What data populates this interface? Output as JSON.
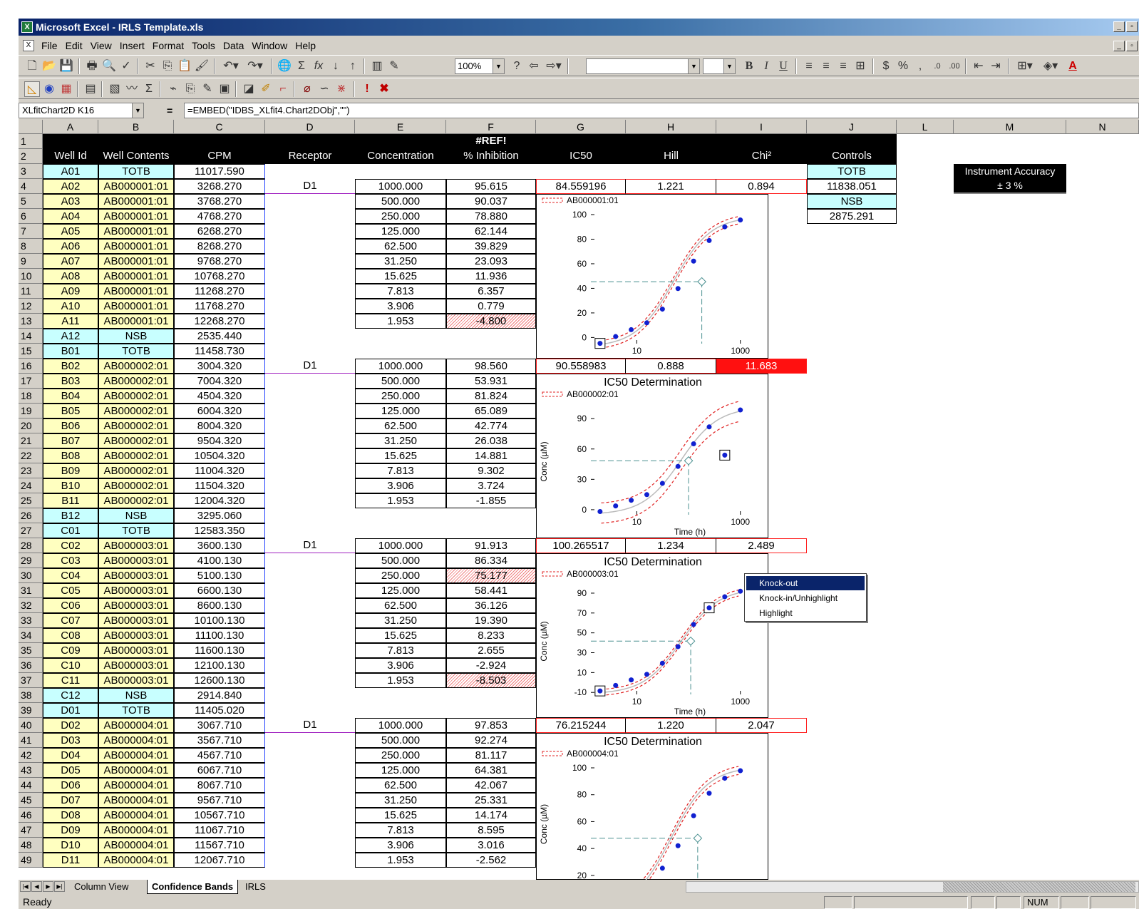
{
  "window": {
    "title": "Microsoft Excel - IRLS Template.xls"
  },
  "menu": [
    "File",
    "Edit",
    "View",
    "Insert",
    "Format",
    "Tools",
    "Data",
    "Window",
    "Help"
  ],
  "toolbar": {
    "zoom": "100%"
  },
  "formula_bar": {
    "name_box": "XLfitChart2D K16",
    "equals": "=",
    "formula": "=EMBED(\"IDBS_XLfit4.Chart2DObj\",\"\")"
  },
  "columns": [
    "A",
    "B",
    "C",
    "D",
    "E",
    "F",
    "G",
    "H",
    "I",
    "J",
    "L",
    "M",
    "N"
  ],
  "headers": {
    "ref": "#REF!",
    "well_id": "Well Id",
    "well_contents": "Well Contents",
    "cpm": "CPM",
    "receptor": "Receptor",
    "concentration": "Concentration",
    "inhibition": "% Inhibition",
    "ic50": "IC50",
    "hill": "Hill",
    "chi": "Chi²",
    "controls": "Controls"
  },
  "controls": {
    "totb_label": "TOTB",
    "totb_value": "11838.051",
    "nsb_label": "NSB",
    "nsb_value": "2875.291"
  },
  "accuracy": {
    "line1": "Instrument Accuracy",
    "line2": "± 3 %"
  },
  "rows": [
    {
      "r": "1"
    },
    {
      "r": "2"
    },
    {
      "r": "3",
      "a": "A01",
      "b": "TOTB",
      "c": "11017.590",
      "t": "ctrl"
    },
    {
      "r": "4",
      "a": "A02",
      "b": "AB000001:01",
      "c": "3268.270",
      "d": "D1",
      "e": "1000.000",
      "f": "95.615"
    },
    {
      "r": "5",
      "a": "A03",
      "b": "AB000001:01",
      "c": "3768.270",
      "e": "500.000",
      "f": "90.037"
    },
    {
      "r": "6",
      "a": "A04",
      "b": "AB000001:01",
      "c": "4768.270",
      "e": "250.000",
      "f": "78.880"
    },
    {
      "r": "7",
      "a": "A05",
      "b": "AB000001:01",
      "c": "6268.270",
      "e": "125.000",
      "f": "62.144"
    },
    {
      "r": "8",
      "a": "A06",
      "b": "AB000001:01",
      "c": "8268.270",
      "e": "62.500",
      "f": "39.829"
    },
    {
      "r": "9",
      "a": "A07",
      "b": "AB000001:01",
      "c": "9768.270",
      "e": "31.250",
      "f": "23.093"
    },
    {
      "r": "10",
      "a": "A08",
      "b": "AB000001:01",
      "c": "10768.270",
      "e": "15.625",
      "f": "11.936"
    },
    {
      "r": "11",
      "a": "A09",
      "b": "AB000001:01",
      "c": "11268.270",
      "e": "7.813",
      "f": "6.357"
    },
    {
      "r": "12",
      "a": "A10",
      "b": "AB000001:01",
      "c": "11768.270",
      "e": "3.906",
      "f": "0.779"
    },
    {
      "r": "13",
      "a": "A11",
      "b": "AB000001:01",
      "c": "12268.270",
      "e": "1.953",
      "f": "-4.800",
      "h": true
    },
    {
      "r": "14",
      "a": "A12",
      "b": "NSB",
      "c": "2535.440",
      "t": "ctrl"
    },
    {
      "r": "15",
      "a": "B01",
      "b": "TOTB",
      "c": "11458.730",
      "t": "ctrl"
    },
    {
      "r": "16",
      "a": "B02",
      "b": "AB000002:01",
      "c": "3004.320",
      "d": "D1",
      "e": "1000.000",
      "f": "98.560"
    },
    {
      "r": "17",
      "a": "B03",
      "b": "AB000002:01",
      "c": "7004.320",
      "e": "500.000",
      "f": "53.931"
    },
    {
      "r": "18",
      "a": "B04",
      "b": "AB000002:01",
      "c": "4504.320",
      "e": "250.000",
      "f": "81.824"
    },
    {
      "r": "19",
      "a": "B05",
      "b": "AB000002:01",
      "c": "6004.320",
      "e": "125.000",
      "f": "65.089"
    },
    {
      "r": "20",
      "a": "B06",
      "b": "AB000002:01",
      "c": "8004.320",
      "e": "62.500",
      "f": "42.774"
    },
    {
      "r": "21",
      "a": "B07",
      "b": "AB000002:01",
      "c": "9504.320",
      "e": "31.250",
      "f": "26.038"
    },
    {
      "r": "22",
      "a": "B08",
      "b": "AB000002:01",
      "c": "10504.320",
      "e": "15.625",
      "f": "14.881"
    },
    {
      "r": "23",
      "a": "B09",
      "b": "AB000002:01",
      "c": "11004.320",
      "e": "7.813",
      "f": "9.302"
    },
    {
      "r": "24",
      "a": "B10",
      "b": "AB000002:01",
      "c": "11504.320",
      "e": "3.906",
      "f": "3.724"
    },
    {
      "r": "25",
      "a": "B11",
      "b": "AB000002:01",
      "c": "12004.320",
      "e": "1.953",
      "f": "-1.855"
    },
    {
      "r": "26",
      "a": "B12",
      "b": "NSB",
      "c": "3295.060",
      "t": "ctrl"
    },
    {
      "r": "27",
      "a": "C01",
      "b": "TOTB",
      "c": "12583.350",
      "t": "ctrl"
    },
    {
      "r": "28",
      "a": "C02",
      "b": "AB000003:01",
      "c": "3600.130",
      "d": "D1",
      "e": "1000.000",
      "f": "91.913"
    },
    {
      "r": "29",
      "a": "C03",
      "b": "AB000003:01",
      "c": "4100.130",
      "e": "500.000",
      "f": "86.334"
    },
    {
      "r": "30",
      "a": "C04",
      "b": "AB000003:01",
      "c": "5100.130",
      "e": "250.000",
      "f": "75.177",
      "h": true
    },
    {
      "r": "31",
      "a": "C05",
      "b": "AB000003:01",
      "c": "6600.130",
      "e": "125.000",
      "f": "58.441"
    },
    {
      "r": "32",
      "a": "C06",
      "b": "AB000003:01",
      "c": "8600.130",
      "e": "62.500",
      "f": "36.126"
    },
    {
      "r": "33",
      "a": "C07",
      "b": "AB000003:01",
      "c": "10100.130",
      "e": "31.250",
      "f": "19.390"
    },
    {
      "r": "34",
      "a": "C08",
      "b": "AB000003:01",
      "c": "11100.130",
      "e": "15.625",
      "f": "8.233"
    },
    {
      "r": "35",
      "a": "C09",
      "b": "AB000003:01",
      "c": "11600.130",
      "e": "7.813",
      "f": "2.655"
    },
    {
      "r": "36",
      "a": "C10",
      "b": "AB000003:01",
      "c": "12100.130",
      "e": "3.906",
      "f": "-2.924"
    },
    {
      "r": "37",
      "a": "C11",
      "b": "AB000003:01",
      "c": "12600.130",
      "e": "1.953",
      "f": "-8.503",
      "h": true
    },
    {
      "r": "38",
      "a": "C12",
      "b": "NSB",
      "c": "2914.840",
      "t": "ctrl"
    },
    {
      "r": "39",
      "a": "D01",
      "b": "TOTB",
      "c": "11405.020",
      "t": "ctrl"
    },
    {
      "r": "40",
      "a": "D02",
      "b": "AB000004:01",
      "c": "3067.710",
      "d": "D1",
      "e": "1000.000",
      "f": "97.853"
    },
    {
      "r": "41",
      "a": "D03",
      "b": "AB000004:01",
      "c": "3567.710",
      "e": "500.000",
      "f": "92.274"
    },
    {
      "r": "42",
      "a": "D04",
      "b": "AB000004:01",
      "c": "4567.710",
      "e": "250.000",
      "f": "81.117"
    },
    {
      "r": "43",
      "a": "D05",
      "b": "AB000004:01",
      "c": "6067.710",
      "e": "125.000",
      "f": "64.381"
    },
    {
      "r": "44",
      "a": "D06",
      "b": "AB000004:01",
      "c": "8067.710",
      "e": "62.500",
      "f": "42.067"
    },
    {
      "r": "45",
      "a": "D07",
      "b": "AB000004:01",
      "c": "9567.710",
      "e": "31.250",
      "f": "25.331"
    },
    {
      "r": "46",
      "a": "D08",
      "b": "AB000004:01",
      "c": "10567.710",
      "e": "15.625",
      "f": "14.174"
    },
    {
      "r": "47",
      "a": "D09",
      "b": "AB000004:01",
      "c": "11067.710",
      "e": "7.813",
      "f": "8.595"
    },
    {
      "r": "48",
      "a": "D10",
      "b": "AB000004:01",
      "c": "11567.710",
      "e": "3.906",
      "f": "3.016"
    },
    {
      "r": "49",
      "a": "D11",
      "b": "AB000004:01",
      "c": "12067.710",
      "e": "1.953",
      "f": "-2.562"
    }
  ],
  "results": [
    {
      "row": "4",
      "ic50": "84.559196",
      "hill": "1.221",
      "chi": "0.894",
      "alert": false
    },
    {
      "row": "16",
      "ic50": "90.558983",
      "hill": "0.888",
      "chi": "11.683",
      "alert": true
    },
    {
      "row": "28",
      "ic50": "100.265517",
      "hill": "1.234",
      "chi": "2.489",
      "alert": false
    },
    {
      "row": "40",
      "ic50": "76.215244",
      "hill": "1.220",
      "chi": "2.047",
      "alert": false
    }
  ],
  "charts": [
    {
      "title": "",
      "legend": "AB000001:01",
      "ylabel": "",
      "xlabel": "",
      "yticks": [
        "0",
        "20",
        "40",
        "60",
        "80",
        "100"
      ],
      "xticks": [
        "10",
        "1000"
      ]
    },
    {
      "title": "IC50 Determination",
      "legend": "AB000002:01",
      "ylabel": "Conc (µM)",
      "xlabel": "Time (h)",
      "yticks": [
        "0",
        "30",
        "60",
        "90"
      ],
      "xticks": [
        "10",
        "1000"
      ]
    },
    {
      "title": "IC50 Determination",
      "legend": "AB000003:01",
      "ylabel": "Conc (µM)",
      "xlabel": "Time (h)",
      "yticks": [
        "-10",
        "10",
        "30",
        "50",
        "70",
        "90"
      ],
      "xticks": [
        "10",
        "1000"
      ]
    },
    {
      "title": "IC50 Determination",
      "legend": "AB000004:01",
      "ylabel": "Conc (µM)",
      "xlabel": "",
      "yticks": [
        "20",
        "40",
        "60",
        "80",
        "100"
      ],
      "xticks": []
    }
  ],
  "context_menu": {
    "items": [
      "Knock-out",
      "Knock-in/Unhighlight",
      "Highlight"
    ],
    "selected": 0
  },
  "sheet_tabs": [
    "Column View",
    "Confidence Bands",
    "IRLS"
  ],
  "active_tab": 1,
  "status": {
    "text": "Ready",
    "num": "NUM"
  },
  "chart_data": [
    {
      "type": "scatter",
      "legend": "AB000001:01",
      "x": [
        1000,
        500,
        250,
        125,
        62.5,
        31.25,
        15.625,
        7.813,
        3.906,
        1.953
      ],
      "y": [
        95.615,
        90.037,
        78.88,
        62.144,
        39.829,
        23.093,
        11.936,
        6.357,
        0.779,
        -4.8
      ],
      "ylim": [
        -5,
        100
      ],
      "ic50": 84.559196,
      "excluded": [
        1.953
      ]
    },
    {
      "type": "scatter",
      "legend": "AB000002:01",
      "x": [
        1000,
        500,
        250,
        125,
        62.5,
        31.25,
        15.625,
        7.813,
        3.906,
        1.953
      ],
      "y": [
        98.56,
        53.931,
        81.824,
        65.089,
        42.774,
        26.038,
        14.881,
        9.302,
        3.724,
        -1.855
      ],
      "ylim": [
        -5,
        100
      ],
      "ic50": 90.558983,
      "excluded": [
        500
      ],
      "xlabel": "Time (h)",
      "ylabel": "Conc (µM)",
      "title": "IC50 Determination"
    },
    {
      "type": "scatter",
      "legend": "AB000003:01",
      "x": [
        1000,
        500,
        250,
        125,
        62.5,
        31.25,
        15.625,
        7.813,
        3.906,
        1.953
      ],
      "y": [
        91.913,
        86.334,
        75.177,
        58.441,
        36.126,
        19.39,
        8.233,
        2.655,
        -2.924,
        -8.503
      ],
      "ylim": [
        -12,
        95
      ],
      "ic50": 100.265517,
      "excluded": [
        250,
        1.953
      ],
      "xlabel": "Time (h)",
      "ylabel": "Conc (µM)",
      "title": "IC50 Determination"
    },
    {
      "type": "scatter",
      "legend": "AB000004:01",
      "x": [
        1000,
        500,
        250,
        125,
        62.5,
        31.25,
        15.625,
        7.813,
        3.906,
        1.953
      ],
      "y": [
        97.853,
        92.274,
        81.117,
        64.381,
        42.067,
        25.331,
        14.174,
        8.595,
        3.016,
        -2.562
      ],
      "ylim": [
        -5,
        100
      ],
      "ic50": 76.215244,
      "excluded": [],
      "ylabel": "Conc (µM)",
      "title": "IC50 Determination"
    }
  ]
}
